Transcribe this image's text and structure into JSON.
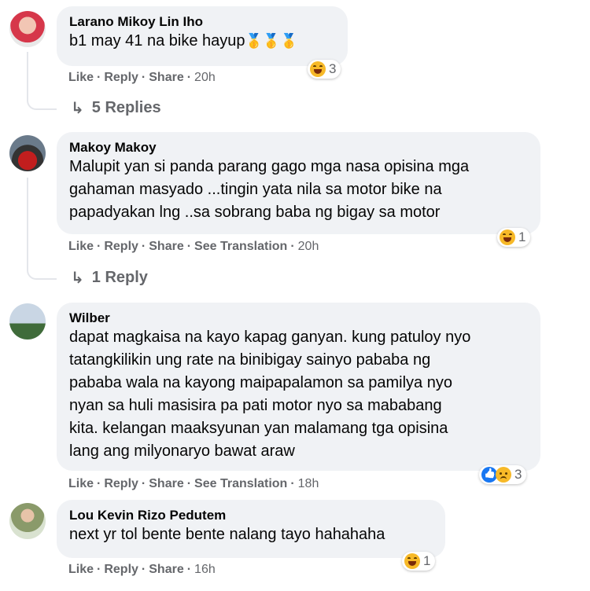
{
  "comments": [
    {
      "author": "Larano Mikoy Lin Iho",
      "text": "b1 may 41 na bike hayup",
      "emoji_suffix": "🥇🥇🥇",
      "actions": {
        "like": "Like",
        "reply": "Reply",
        "share": "Share",
        "time": "20h"
      },
      "reactions": {
        "types": [
          "haha"
        ],
        "count": "3"
      },
      "replies": "5 Replies"
    },
    {
      "author": "Makoy Makoy",
      "text": "Malupit yan si panda parang gago mga nasa opisina mga\ngahaman masyado ...tingin yata nila sa motor bike na\npapadyakan lng ..sa sobrang baba ng bigay sa motor",
      "actions": {
        "like": "Like",
        "reply": "Reply",
        "share": "Share",
        "translate": "See Translation",
        "time": "20h"
      },
      "reactions": {
        "types": [
          "haha"
        ],
        "count": "1"
      },
      "replies": "1 Reply"
    },
    {
      "author": "Wilber",
      "text": "dapat magkaisa na kayo kapag ganyan. kung patuloy nyo\ntatangkilikin ung rate na binibigay sainyo pababa ng\npababa wala na kayong maipapalamon sa pamilya nyo\nnyan sa huli masisira pa pati motor nyo sa mababang\nkita. kelangan maaksyunan yan malamang tga opisina\nlang ang milyonaryo bawat araw",
      "actions": {
        "like": "Like",
        "reply": "Reply",
        "share": "Share",
        "translate": "See Translation",
        "time": "18h"
      },
      "reactions": {
        "types": [
          "like",
          "sad"
        ],
        "count": "3"
      }
    },
    {
      "author": "Lou Kevin Rizo Pedutem",
      "text": "next yr tol bente bente nalang tayo hahahaha",
      "actions": {
        "like": "Like",
        "reply": "Reply",
        "share": "Share",
        "time": "16h"
      },
      "reactions": {
        "types": [
          "haha"
        ],
        "count": "1"
      }
    }
  ],
  "separator": "·",
  "reply_arrow": "↳",
  "colors": {
    "bubble": "#f0f2f5",
    "meta": "#65676b",
    "text": "#050505",
    "like_blue": "#1877f2",
    "haha_yellow": "#f7b928"
  }
}
